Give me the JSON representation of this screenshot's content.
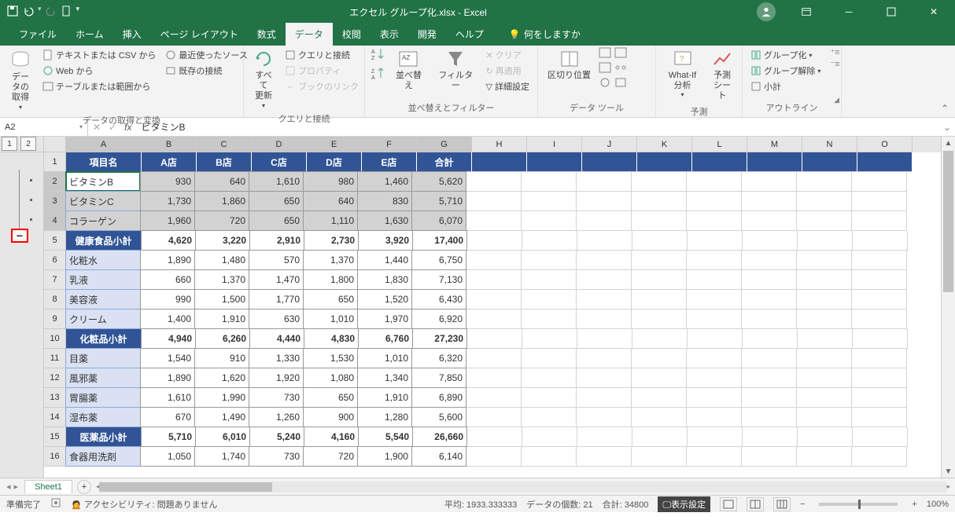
{
  "title": "エクセル グループ化.xlsx - Excel",
  "menu": {
    "file": "ファイル"
  },
  "tabs": [
    "ホーム",
    "挿入",
    "ページ レイアウト",
    "数式",
    "データ",
    "校閲",
    "表示",
    "開発",
    "ヘルプ"
  ],
  "active_tab": "データ",
  "tellme": "何をしますか",
  "ribbon": {
    "g1": {
      "label": "データの取得と変換",
      "get_data": "データの\n取得",
      "from_text": "テキストまたは CSV から",
      "from_web": "Web から",
      "from_table": "テーブルまたは範囲から",
      "recent": "最近使ったソース",
      "existing": "既存の接続"
    },
    "g2": {
      "label": "クエリと接続",
      "refresh": "すべて\n更新",
      "queries": "クエリと接続",
      "props": "プロパティ",
      "links": "ブックのリンク"
    },
    "g3": {
      "label": "並べ替えとフィルター",
      "sort": "並べ替え",
      "filter": "フィルター",
      "clear": "クリア",
      "reapply": "再適用",
      "advanced": "詳細設定"
    },
    "g4": {
      "label": "データ ツール",
      "text_to_cols": "区切り位置"
    },
    "g5": {
      "label": "予測",
      "whatif": "What-If 分析",
      "forecast": "予測\nシート"
    },
    "g6": {
      "label": "アウトライン",
      "group": "グループ化",
      "ungroup": "グループ解除",
      "subtotal": "小計"
    }
  },
  "name_box": "A2",
  "formula": "ビタミンB",
  "cols": [
    "A",
    "B",
    "C",
    "D",
    "E",
    "F",
    "G",
    "H",
    "I",
    "J",
    "K",
    "L",
    "M",
    "N",
    "O"
  ],
  "outline_levels": [
    "1",
    "2"
  ],
  "headers": [
    "項目名",
    "A店",
    "B店",
    "C店",
    "D店",
    "E店",
    "合計"
  ],
  "rows": [
    {
      "n": 2,
      "l": "ビタミンB",
      "v": [
        930,
        640,
        1610,
        980,
        1460,
        5620
      ],
      "sel": true,
      "active": true
    },
    {
      "n": 3,
      "l": "ビタミンC",
      "v": [
        1730,
        1860,
        650,
        640,
        830,
        5710
      ],
      "sel": true
    },
    {
      "n": 4,
      "l": "コラーゲン",
      "v": [
        1960,
        720,
        650,
        1110,
        1630,
        6070
      ],
      "sel": true
    },
    {
      "n": 5,
      "l": "健康食品小計",
      "v": [
        4620,
        3220,
        2910,
        2730,
        3920,
        17400
      ],
      "sub": true
    },
    {
      "n": 6,
      "l": "化粧水",
      "v": [
        1890,
        1480,
        570,
        1370,
        1440,
        6750
      ]
    },
    {
      "n": 7,
      "l": "乳液",
      "v": [
        660,
        1370,
        1470,
        1800,
        1830,
        7130
      ]
    },
    {
      "n": 8,
      "l": "美容液",
      "v": [
        990,
        1500,
        1770,
        650,
        1520,
        6430
      ]
    },
    {
      "n": 9,
      "l": "クリーム",
      "v": [
        1400,
        1910,
        630,
        1010,
        1970,
        6920
      ]
    },
    {
      "n": 10,
      "l": "化粧品小計",
      "v": [
        4940,
        6260,
        4440,
        4830,
        6760,
        27230
      ],
      "sub": true
    },
    {
      "n": 11,
      "l": "目薬",
      "v": [
        1540,
        910,
        1330,
        1530,
        1010,
        6320
      ]
    },
    {
      "n": 12,
      "l": "風邪薬",
      "v": [
        1890,
        1620,
        1920,
        1080,
        1340,
        7850
      ]
    },
    {
      "n": 13,
      "l": "胃腸薬",
      "v": [
        1610,
        1990,
        730,
        650,
        1910,
        6890
      ]
    },
    {
      "n": 14,
      "l": "湿布薬",
      "v": [
        670,
        1490,
        1260,
        900,
        1280,
        5600
      ]
    },
    {
      "n": 15,
      "l": "医薬品小計",
      "v": [
        5710,
        6010,
        5240,
        4160,
        5540,
        26660
      ],
      "sub": true
    },
    {
      "n": 16,
      "l": "食器用洗剤",
      "v": [
        1050,
        1740,
        730,
        720,
        1900,
        6140
      ]
    }
  ],
  "sheet": "Sheet1",
  "status": {
    "ready": "準備完了",
    "access": "アクセシビリティ: 問題ありません",
    "avg_l": "平均:",
    "avg_v": "1933.333333",
    "cnt_l": "データの個数:",
    "cnt_v": "21",
    "sum_l": "合計:",
    "sum_v": "34800",
    "display": "表示設定",
    "zoom": "100%"
  }
}
